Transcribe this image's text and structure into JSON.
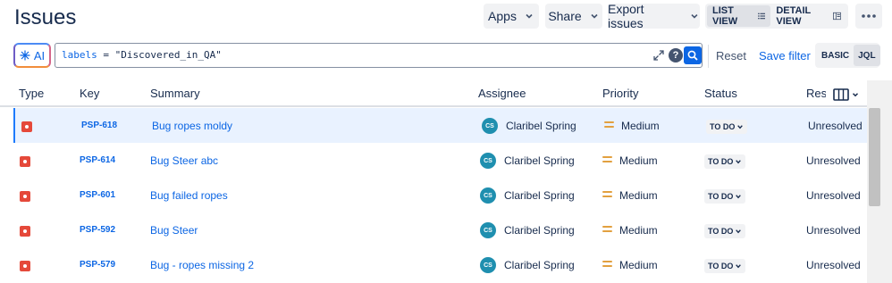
{
  "header": {
    "title": "Issues"
  },
  "toolbar": {
    "apps_label": "Apps",
    "share_label": "Share",
    "export_label": "Export issues",
    "list_view_label": "LIST VIEW",
    "detail_view_label": "DETAIL VIEW"
  },
  "search": {
    "ai_label": "AI",
    "query_field": "labels",
    "query_rest": " = \"Discovered_in_QA\"",
    "reset_label": "Reset",
    "save_filter_label": "Save filter",
    "basic_label": "BASIC",
    "jql_label": "JQL"
  },
  "table": {
    "columns": [
      "Type",
      "Key",
      "Summary",
      "Assignee",
      "Priority",
      "Status",
      "Reso"
    ],
    "rows": [
      {
        "key": "PSP-618",
        "summary": "Bug ropes moldy",
        "assignee_initials": "CS",
        "assignee": "Claribel Spring",
        "priority": "Medium",
        "status": "TO DO",
        "resolution": "Unresolved",
        "selected": true
      },
      {
        "key": "PSP-614",
        "summary": "Bug Steer abc",
        "assignee_initials": "CS",
        "assignee": "Claribel Spring",
        "priority": "Medium",
        "status": "TO DO",
        "resolution": "Unresolved"
      },
      {
        "key": "PSP-601",
        "summary": "Bug failed ropes",
        "assignee_initials": "CS",
        "assignee": "Claribel Spring",
        "priority": "Medium",
        "status": "TO DO",
        "resolution": "Unresolved"
      },
      {
        "key": "PSP-592",
        "summary": "Bug Steer",
        "assignee_initials": "CS",
        "assignee": "Claribel Spring",
        "priority": "Medium",
        "status": "TO DO",
        "resolution": "Unresolved"
      },
      {
        "key": "PSP-579",
        "summary": "Bug - ropes missing 2",
        "assignee_initials": "CS",
        "assignee": "Claribel Spring",
        "priority": "Medium",
        "status": "TO DO",
        "resolution": "Unresolved"
      }
    ]
  },
  "colors": {
    "accent": "#0c66e4",
    "bug": "#e5493a",
    "priority_medium": "#e2a03f",
    "avatar": "#1f8faf",
    "selected_row": "#e9f2ff"
  },
  "icons": [
    "chevron-down-icon",
    "list-view-icon",
    "detail-view-icon",
    "more-icon",
    "ai-sparkle-icon",
    "expand-icon",
    "help-icon",
    "search-icon",
    "bug-icon",
    "priority-medium-icon",
    "columns-icon"
  ]
}
